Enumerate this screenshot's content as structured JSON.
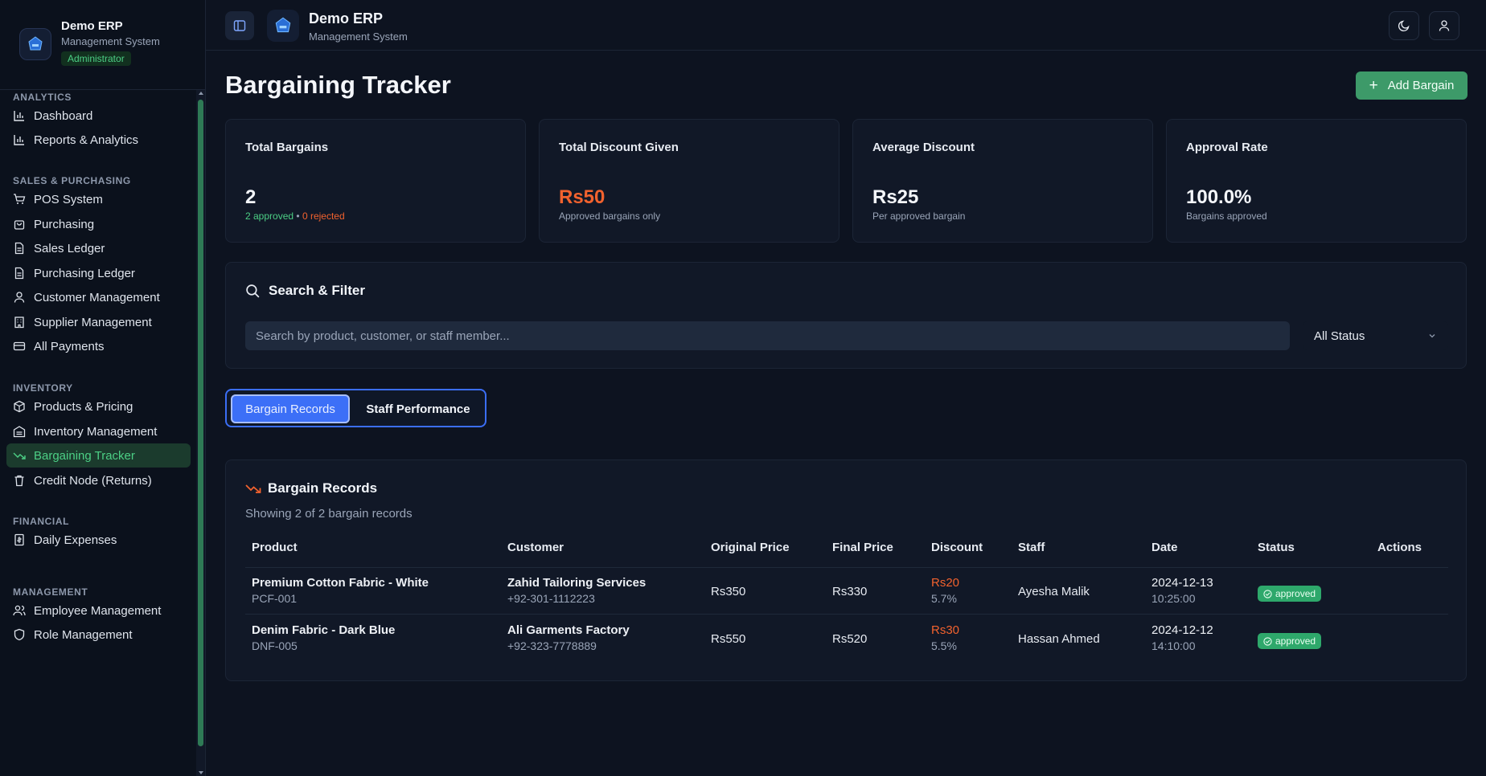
{
  "sidebar": {
    "brand_title": "Demo ERP",
    "brand_subtitle": "Management System",
    "role": "Administrator",
    "sections": {
      "analytics": "ANALYTICS",
      "sales": "SALES & PURCHASING",
      "inventory": "INVENTORY",
      "financial": "FINANCIAL",
      "management": "MANAGEMENT"
    },
    "items": {
      "dashboard": "Dashboard",
      "reports": "Reports & Analytics",
      "pos": "POS System",
      "purchasing": "Purchasing",
      "sales_ledger": "Sales Ledger",
      "purchasing_ledger": "Purchasing Ledger",
      "customers": "Customer Management",
      "suppliers": "Supplier Management",
      "payments": "All Payments",
      "products": "Products & Pricing",
      "inventory": "Inventory Management",
      "bargaining": "Bargaining Tracker",
      "credit_node": "Credit Node (Returns)",
      "expenses": "Daily Expenses",
      "employees": "Employee Management",
      "roles": "Role Management"
    },
    "active_item": "bargaining"
  },
  "header": {
    "title": "Demo ERP",
    "subtitle": "Management System"
  },
  "page": {
    "title": "Bargaining Tracker",
    "add_button": "Add Bargain"
  },
  "stats": {
    "total": {
      "label": "Total Bargains",
      "value": "2",
      "approved": "2 approved",
      "separator": "•",
      "rejected": "0 rejected"
    },
    "discount": {
      "label": "Total Discount Given",
      "value": "Rs50",
      "sub": "Approved bargains only"
    },
    "average": {
      "label": "Average Discount",
      "value": "Rs25",
      "sub": "Per approved bargain"
    },
    "approval": {
      "label": "Approval Rate",
      "value": "100.0%",
      "sub": "Bargains approved"
    }
  },
  "filter": {
    "title": "Search & Filter",
    "search_placeholder": "Search by product, customer, or staff member...",
    "status_value": "All Status"
  },
  "tabs": {
    "records": "Bargain Records",
    "staff": "Staff Performance"
  },
  "records": {
    "title": "Bargain Records",
    "summary": "Showing 2 of 2 bargain records",
    "columns": {
      "product": "Product",
      "customer": "Customer",
      "original": "Original Price",
      "final": "Final Price",
      "discount": "Discount",
      "staff": "Staff",
      "date": "Date",
      "status": "Status",
      "actions": "Actions"
    },
    "rows": [
      {
        "product": "Premium Cotton Fabric - White",
        "sku": "PCF-001",
        "customer": "Zahid Tailoring Services",
        "phone": "+92-301-1112223",
        "original": "Rs350",
        "final": "Rs330",
        "discount": "Rs20",
        "discount_pct": "5.7%",
        "staff": "Ayesha Malik",
        "date": "2024-12-13",
        "time": "10:25:00",
        "status": "approved"
      },
      {
        "product": "Denim Fabric - Dark Blue",
        "sku": "DNF-005",
        "customer": "Ali Garments Factory",
        "phone": "+92-323-7778889",
        "original": "Rs550",
        "final": "Rs520",
        "discount": "Rs30",
        "discount_pct": "5.5%",
        "staff": "Hassan Ahmed",
        "date": "2024-12-12",
        "time": "14:10:00",
        "status": "approved"
      }
    ]
  },
  "colors": {
    "accent_green": "#3d9a69",
    "accent_blue": "#3c6ff7",
    "discount_orange": "#f2622e",
    "background": "#0d1320"
  }
}
